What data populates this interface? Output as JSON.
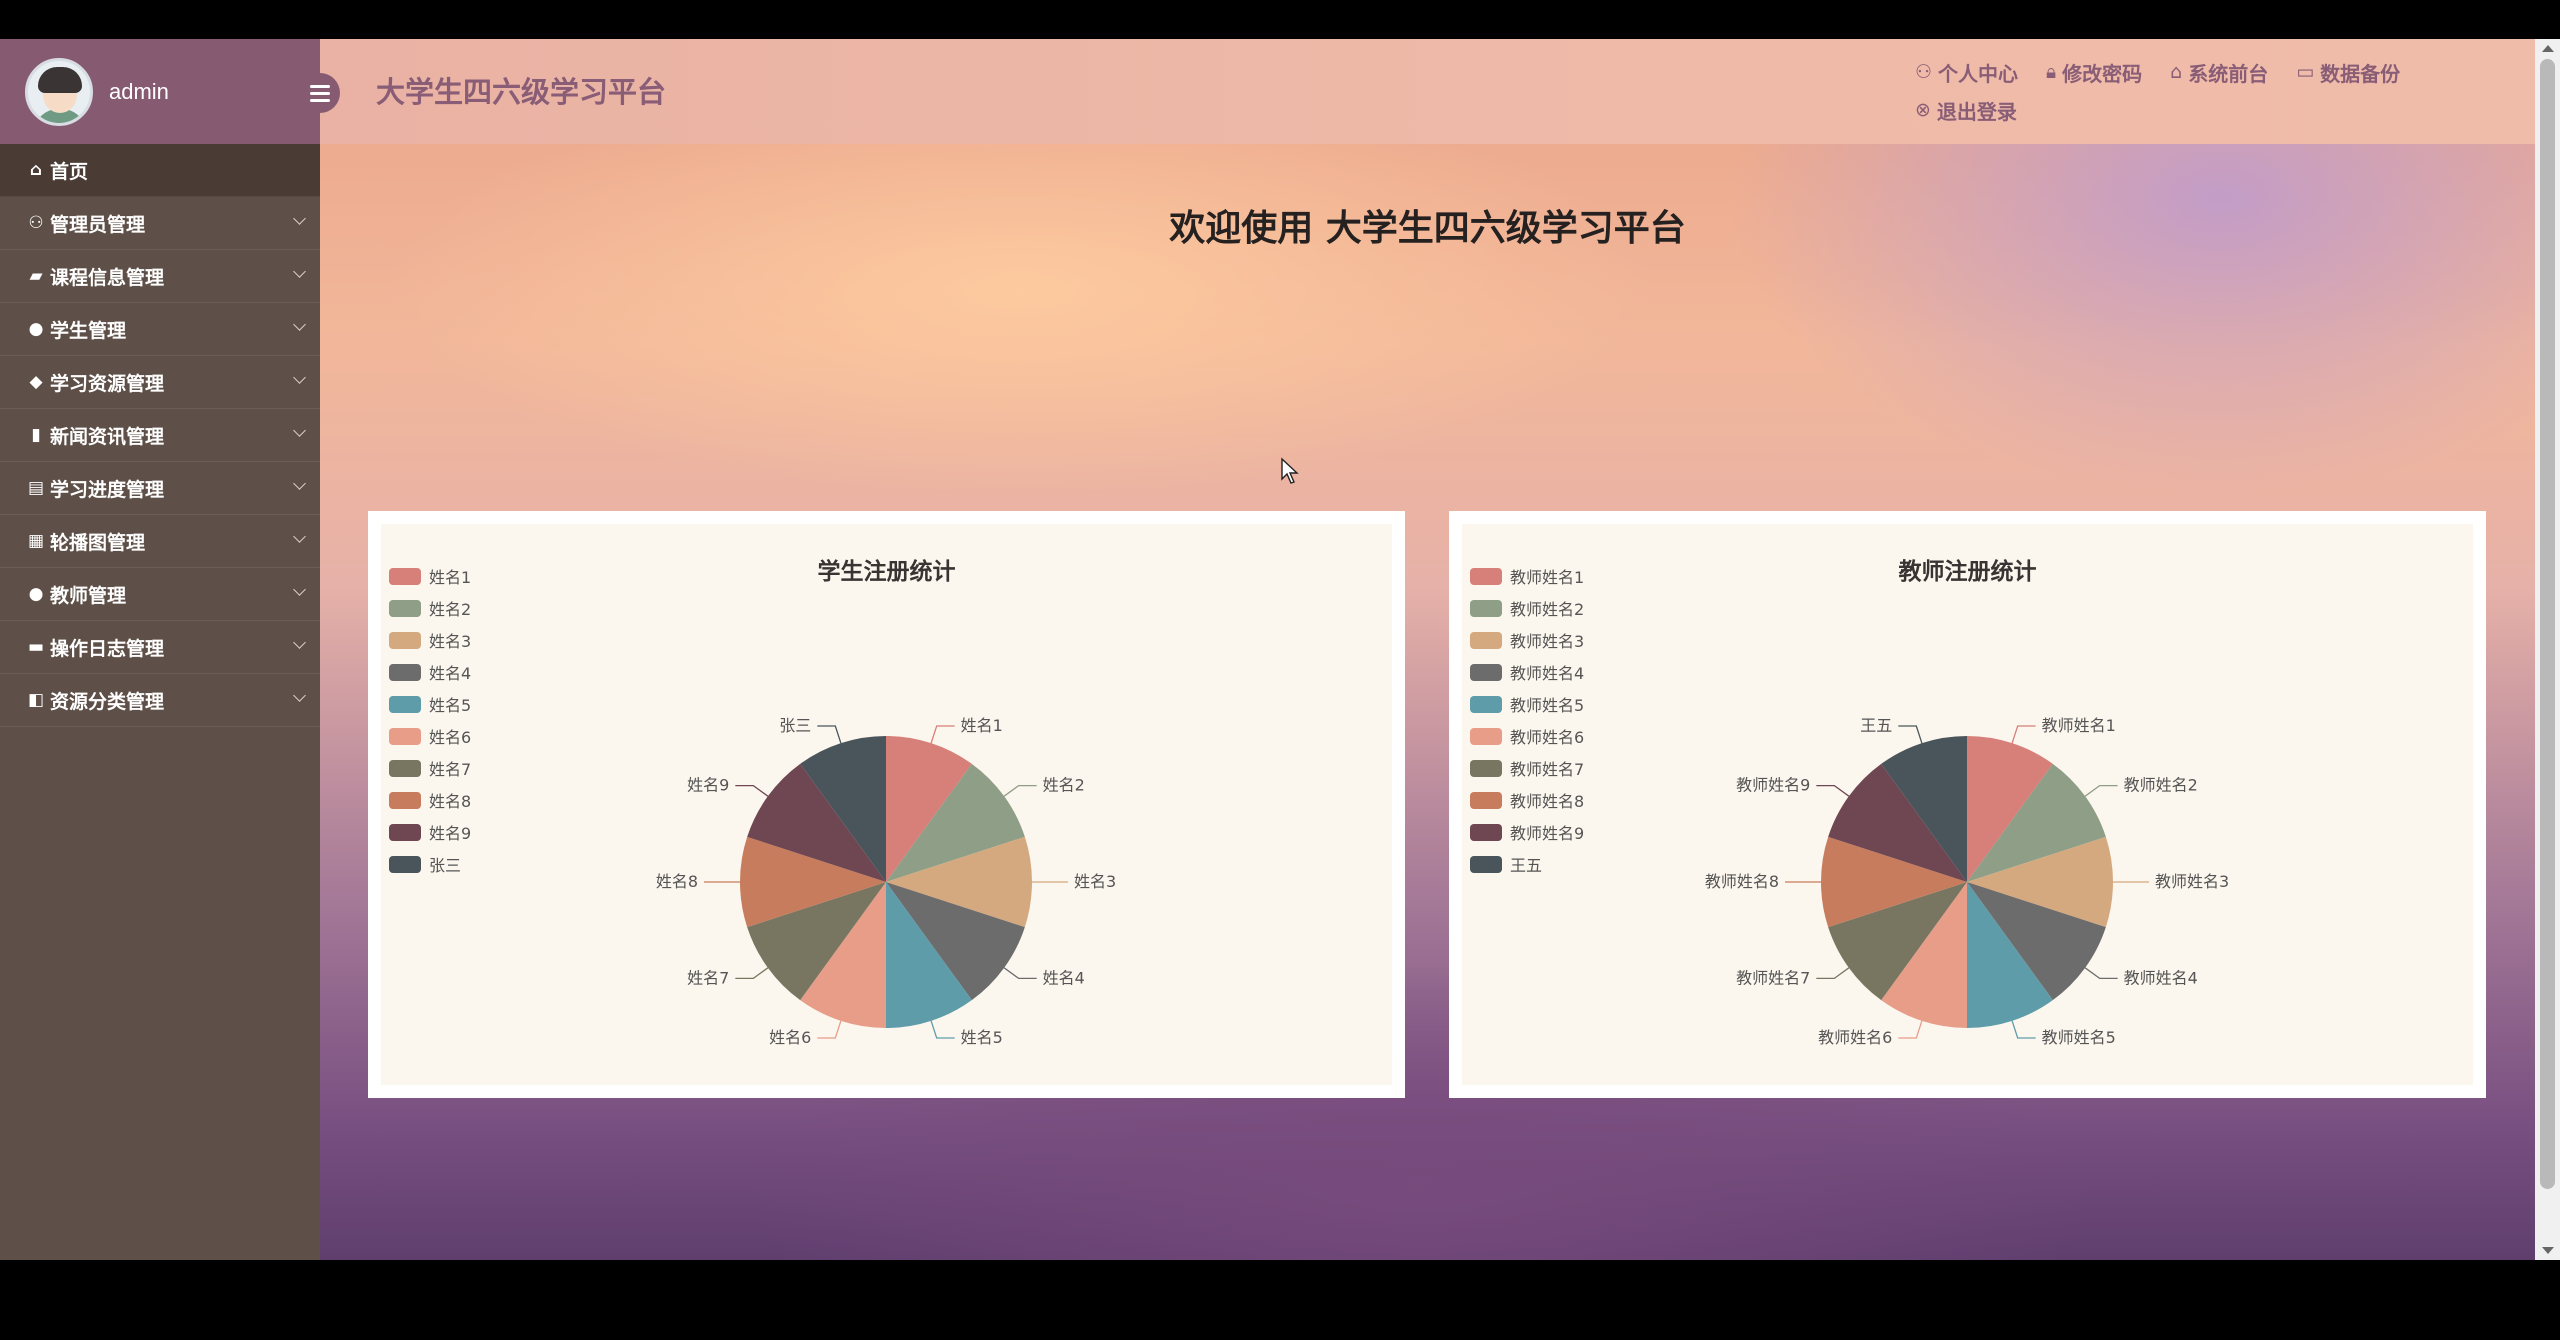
{
  "user": {
    "name": "admin"
  },
  "sidebar": {
    "items": [
      {
        "label": "首页",
        "icon": "home-icon"
      },
      {
        "label": "管理员管理",
        "icon": "user-icon"
      },
      {
        "label": "课程信息管理",
        "icon": "folder-icon"
      },
      {
        "label": "学生管理",
        "icon": "user-icon"
      },
      {
        "label": "学习资源管理",
        "icon": "water-drop-icon"
      },
      {
        "label": "新闻资讯管理",
        "icon": "book-icon"
      },
      {
        "label": "学习进度管理",
        "icon": "copy-icon"
      },
      {
        "label": "轮播图管理",
        "icon": "grid-icon"
      },
      {
        "label": "教师管理",
        "icon": "user-icon"
      },
      {
        "label": "操作日志管理",
        "icon": "calendar-icon"
      },
      {
        "label": "资源分类管理",
        "icon": "panel-icon"
      }
    ]
  },
  "header": {
    "title": "大学生四六级学习平台",
    "links": {
      "profile": "个人中心",
      "password": "修改密码",
      "frontend": "系统前台",
      "backup": "数据备份",
      "logout": "退出登录"
    }
  },
  "welcome": "欢迎使用 大学生四六级学习平台",
  "colors": [
    "#d77f79",
    "#8f9e86",
    "#d4a97f",
    "#6d6c6c",
    "#5e9caa",
    "#e89d89",
    "#787661",
    "#c77c5d",
    "#6e4752",
    "#4a555b"
  ],
  "chart_data": [
    {
      "type": "pie",
      "title": "学生注册统计",
      "categories": [
        "姓名1",
        "姓名2",
        "姓名3",
        "姓名4",
        "姓名5",
        "姓名6",
        "姓名7",
        "姓名8",
        "姓名9",
        "张三"
      ],
      "values": [
        1,
        1,
        1,
        1,
        1,
        1,
        1,
        1,
        1,
        1
      ]
    },
    {
      "type": "pie",
      "title": "教师注册统计",
      "categories": [
        "教师姓名1",
        "教师姓名2",
        "教师姓名3",
        "教师姓名4",
        "教师姓名5",
        "教师姓名6",
        "教师姓名7",
        "教师姓名8",
        "教师姓名9",
        "王五"
      ],
      "values": [
        1,
        1,
        1,
        1,
        1,
        1,
        1,
        1,
        1,
        1
      ]
    }
  ]
}
